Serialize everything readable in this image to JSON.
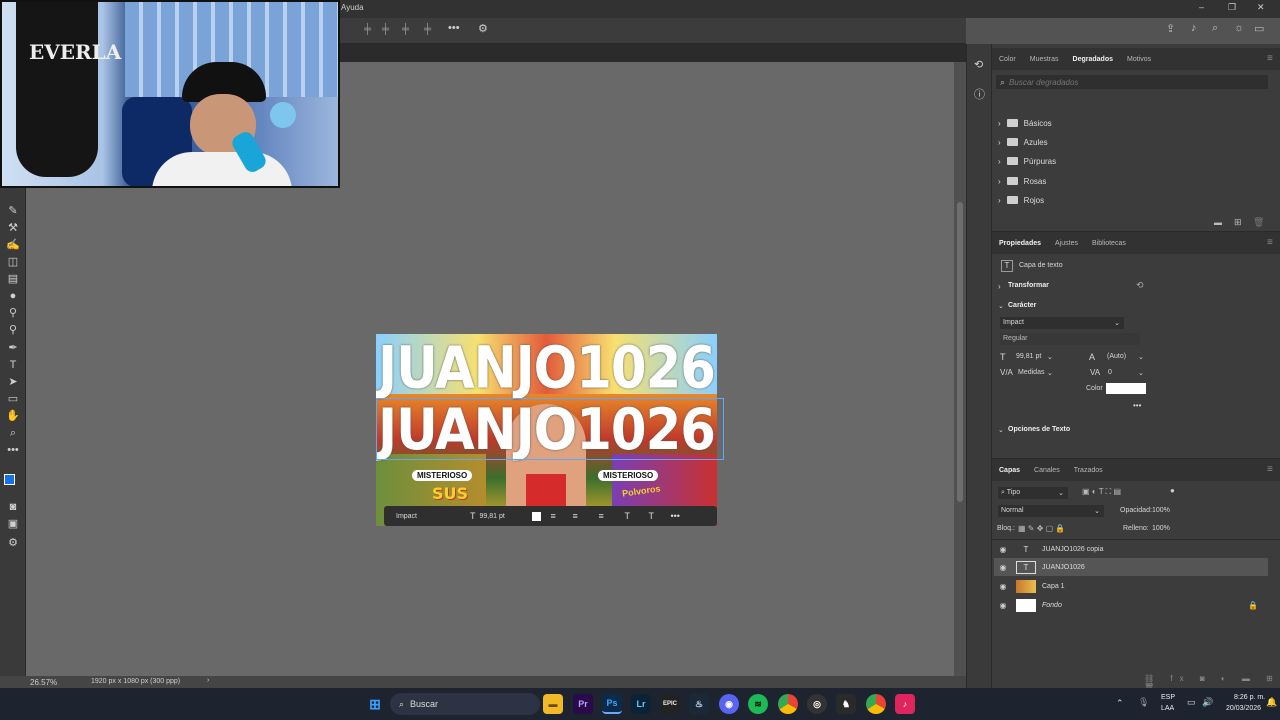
{
  "menu": {
    "ayuda": "Ayuda"
  },
  "doc": {
    "zoom": "26.57%",
    "size_info": "1920 px x 1080 px (300 ppp)"
  },
  "canvas": {
    "line1": "JUANJO1026",
    "line2": "JUANJO1026",
    "sticker1": "MISTERIOSO",
    "sticker2": "MISTERIOSO",
    "sticker3": "SUS",
    "sticker4": "Polvoros"
  },
  "ctxbar": {
    "font": "Impact",
    "size": "99,81 pt"
  },
  "gradients": {
    "tabs": [
      "Color",
      "Muestras",
      "Degradados",
      "Motivos"
    ],
    "active_tab": "Degradados",
    "search_placeholder": "Buscar degradados",
    "folders": [
      "Básicos",
      "Azules",
      "Púrpuras",
      "Rosas",
      "Rojos"
    ]
  },
  "properties": {
    "tabs": [
      "Propiedades",
      "Ajustes",
      "Bibliotecas"
    ],
    "active_tab": "Propiedades",
    "layer_type": "Capa de texto",
    "transform": "Transformar",
    "character": "Carácter",
    "font_family": "Impact",
    "font_style": "Regular",
    "size": "99,81 pt",
    "leading": "(Auto)",
    "kerning": "Medidas",
    "tracking": "0",
    "color_label": "Color",
    "more": "•••",
    "text_options": "Opciones de Texto"
  },
  "layers": {
    "tabs": [
      "Capas",
      "Canales",
      "Trazados"
    ],
    "active_tab": "Capas",
    "filter": "Tipo",
    "blend": "Normal",
    "opacity_label": "Opacidad:",
    "opacity": "100%",
    "lock_label": "Bloq.:",
    "fill_label": "Relleno:",
    "fill": "100%",
    "items": [
      "JUANJO1026 copia",
      "JUANJO1026",
      "Capa 1",
      "Fondo"
    ]
  },
  "taskbar": {
    "search": "Buscar",
    "lang1": "ESP",
    "lang2": "LAA",
    "time": "8:26 p. m.",
    "date": "20/03/2026"
  },
  "webcam": {
    "bag_text": "EVERLA"
  },
  "colors": {
    "accent": "#1473e6",
    "panel": "#3c3c3c",
    "canvas": "#696969",
    "taskbar": "#1d2430"
  }
}
